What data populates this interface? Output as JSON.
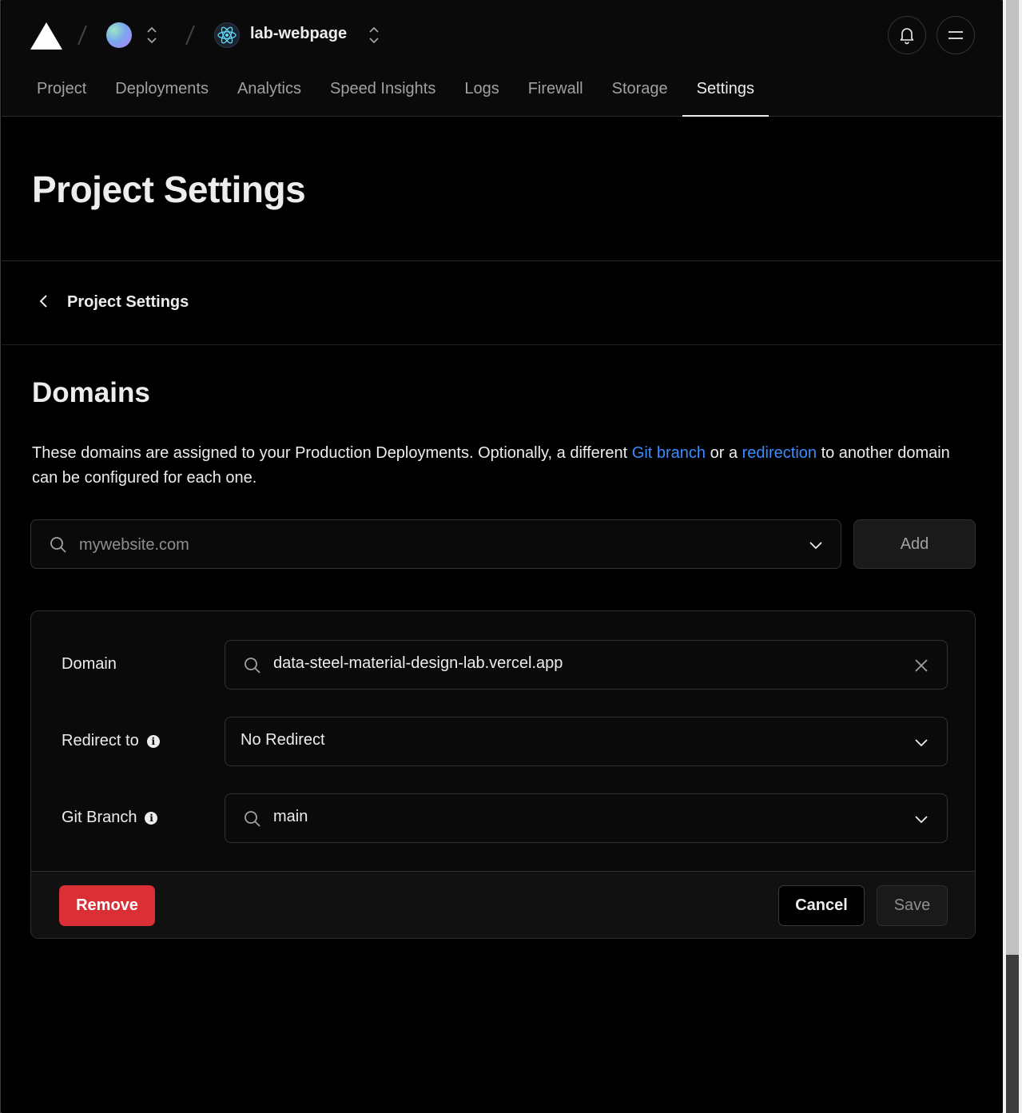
{
  "header": {
    "project_name": "lab-webpage",
    "nav": [
      {
        "label": "Project"
      },
      {
        "label": "Deployments"
      },
      {
        "label": "Analytics"
      },
      {
        "label": "Speed Insights"
      },
      {
        "label": "Logs"
      },
      {
        "label": "Firewall"
      },
      {
        "label": "Storage"
      },
      {
        "label": "Settings",
        "active": true
      }
    ]
  },
  "page": {
    "title": "Project Settings",
    "back_label": "Project Settings"
  },
  "domains": {
    "title": "Domains",
    "desc_part1": "These domains are assigned to your Production Deployments. Optionally, a different ",
    "desc_link1": "Git branch",
    "desc_part2": " or a ",
    "desc_link2": "redirection",
    "desc_part3": " to another domain can be configured for each one.",
    "search_placeholder": "mywebsite.com",
    "add_label": "Add",
    "card": {
      "domain_label": "Domain",
      "domain_value": "data-steel-material-design-lab.vercel.app",
      "redirect_label": "Redirect to",
      "redirect_value": "No Redirect",
      "branch_label": "Git Branch",
      "branch_value": "main",
      "remove_label": "Remove",
      "cancel_label": "Cancel",
      "save_label": "Save"
    }
  },
  "colors": {
    "link": "#3b8cff",
    "danger": "#da2f35",
    "background": "#000000"
  },
  "icons": [
    "vercel-logo-icon",
    "chevron-up-down-icon",
    "react-icon",
    "bell-icon",
    "menu-icon",
    "chevron-left-icon",
    "search-icon",
    "chevron-down-icon",
    "close-icon",
    "info-icon"
  ]
}
